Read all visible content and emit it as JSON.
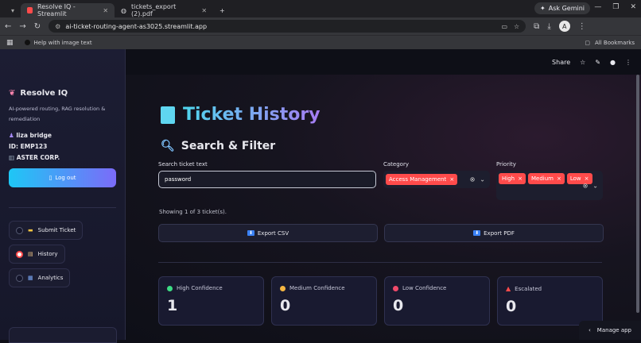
{
  "browser": {
    "tabs": [
      {
        "label": "Resolve IQ - Streamlit",
        "active": true
      },
      {
        "label": "tickets_export (2).pdf",
        "active": false
      }
    ],
    "new_tab": "+",
    "gemini": "Ask Gemini",
    "url": "ai-ticket-routing-agent-as3025.streamlit.app",
    "bookmarks": {
      "help": "Help with image text",
      "all": "All Bookmarks"
    },
    "avatar": "A"
  },
  "topbar": {
    "share": "Share"
  },
  "sidebar": {
    "brand": "Resolve IQ",
    "tagline": "AI-powered routing, RAG resolution & remediation",
    "user_name": "liza bridge",
    "user_id": "ID: EMP123",
    "company": "ASTER CORP.",
    "logout": "Log out",
    "nav": [
      {
        "label": "Submit Ticket",
        "selected": false
      },
      {
        "label": "History",
        "selected": true
      },
      {
        "label": "Analytics",
        "selected": false
      }
    ]
  },
  "main": {
    "title": "Ticket History",
    "section": "Search & Filter",
    "search": {
      "label": "Search ticket text",
      "value": "password"
    },
    "category": {
      "label": "Category",
      "chips": [
        "Access Management"
      ]
    },
    "priority": {
      "label": "Priority",
      "chips": [
        "High",
        "Medium",
        "Low"
      ]
    },
    "showing": "Showing 1 of 3 ticket(s).",
    "export_csv": "Export CSV",
    "export_pdf": "Export PDF",
    "metrics": [
      {
        "label": "High Confidence",
        "value": "1",
        "color": "#3ddc84"
      },
      {
        "label": "Medium Confidence",
        "value": "0",
        "color": "#f5b642"
      },
      {
        "label": "Low Confidence",
        "value": "0",
        "color": "#f04a6a"
      },
      {
        "label": "Escalated",
        "value": "0",
        "color": "#ff4b4b"
      }
    ]
  },
  "manage_app": "Manage app"
}
